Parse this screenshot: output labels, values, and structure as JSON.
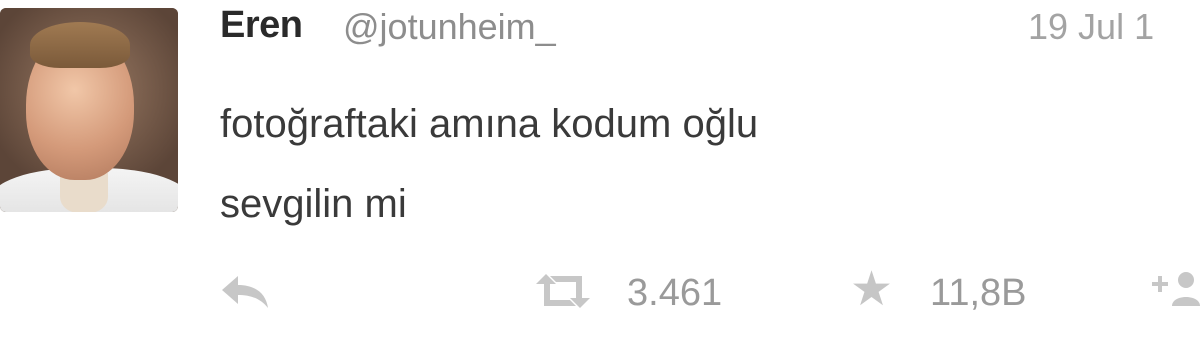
{
  "user": {
    "name": "Eren",
    "handle": "@jotunheim_"
  },
  "tweet": {
    "date": "19 Jul 1",
    "text_line1": "fotoğraftaki amına kodum oğlu",
    "text_line2": "sevgilin mi"
  },
  "actions": {
    "retweet_count": "3.461",
    "favorite_count": "11,8B"
  },
  "icons": {
    "reply": "reply-icon",
    "retweet": "retweet-icon",
    "favorite": "star-icon",
    "follow": "follow-icon"
  },
  "colors": {
    "name": "#2a2a2a",
    "muted": "#8d8d8d",
    "icon": "#c4c4c4"
  }
}
